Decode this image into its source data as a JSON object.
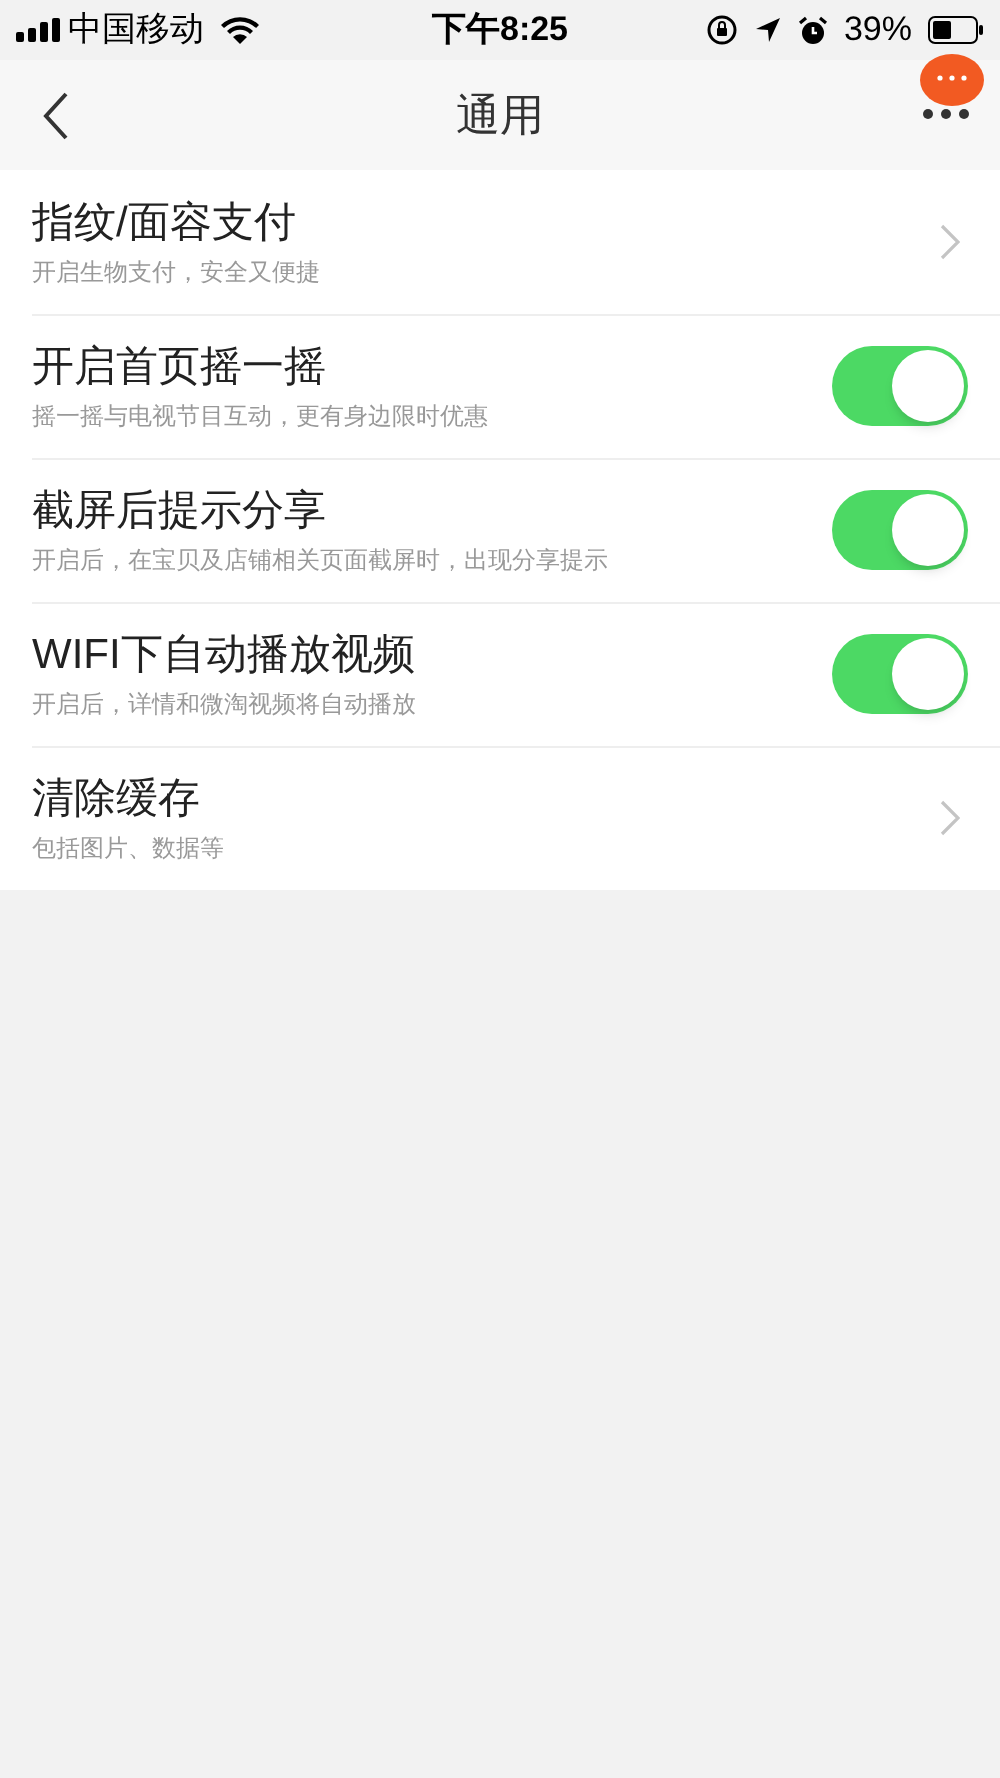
{
  "status_bar": {
    "carrier": "中国移动",
    "time": "下午8:25",
    "battery": "39%"
  },
  "nav": {
    "title": "通用"
  },
  "settings": [
    {
      "kind": "link",
      "title": "指纹/面容支付",
      "subtitle": "开启生物支付，安全又便捷"
    },
    {
      "kind": "toggle",
      "title": "开启首页摇一摇",
      "subtitle": "摇一摇与电视节目互动，更有身边限时优惠",
      "on": true
    },
    {
      "kind": "toggle",
      "title": "截屏后提示分享",
      "subtitle": "开启后，在宝贝及店铺相关页面截屏时，出现分享提示",
      "on": true
    },
    {
      "kind": "toggle",
      "title": "WIFI下自动播放视频",
      "subtitle": "开启后，详情和微淘视频将自动播放",
      "on": true
    },
    {
      "kind": "link",
      "title": "清除缓存",
      "subtitle": "包括图片、数据等"
    }
  ]
}
